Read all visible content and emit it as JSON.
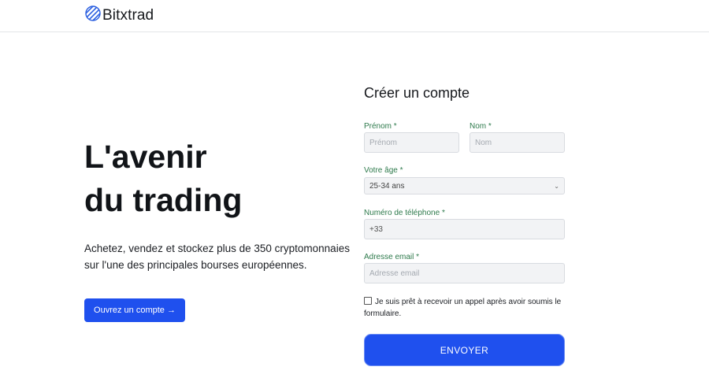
{
  "brand": {
    "name": "Bitxtrad",
    "icon": "striped-globe-icon"
  },
  "hero": {
    "title_line1": "L'avenir",
    "title_line2": "du trading",
    "subtitle": "Achetez, vendez et stockez plus de 350 cryptomonnaies sur l'une des principales bourses européennes.",
    "cta_label": "Ouvrez un compte →"
  },
  "form": {
    "title": "Créer un compte",
    "required_mark": "*",
    "first_name": {
      "label": "Prénom",
      "placeholder": "Prénom"
    },
    "last_name": {
      "label": "Nom",
      "placeholder": "Nom"
    },
    "age": {
      "label": "Votre âge",
      "selected": "25-34 ans"
    },
    "phone": {
      "label": "Numéro de téléphone",
      "value": "+33"
    },
    "email": {
      "label": "Adresse email",
      "placeholder": "Adresse email"
    },
    "consent": "Je suis prêt à recevoir un appel après avoir soumis le formulaire.",
    "submit_label": "ENVOYER"
  },
  "colors": {
    "accent": "#1f50ee",
    "label_green": "#2e7a4c"
  }
}
